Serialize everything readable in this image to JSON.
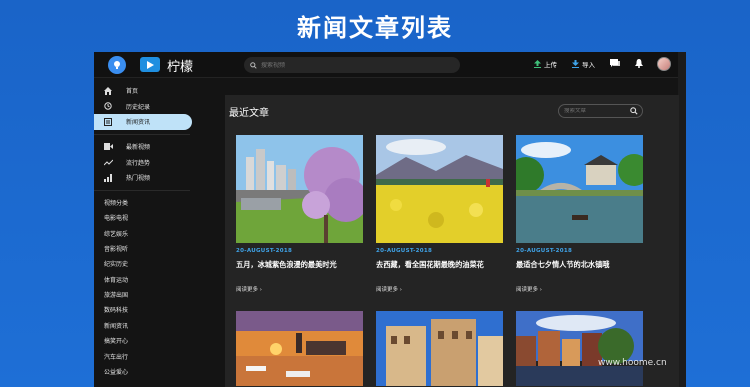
{
  "banner": {
    "title": "新闻文章列表"
  },
  "header": {
    "logo_text": "柠檬",
    "search_placeholder": "搜索视频",
    "upload_label": "上传",
    "import_label": "导入"
  },
  "sidebar": {
    "items": [
      {
        "label": "首页",
        "icon": "home-icon"
      },
      {
        "label": "历史纪录",
        "icon": "history-icon"
      },
      {
        "label": "新闻资讯",
        "icon": "news-icon",
        "active": true
      },
      {
        "label": "最新视频",
        "icon": "video-icon"
      },
      {
        "label": "流行趋势",
        "icon": "trend-icon"
      },
      {
        "label": "热门视频",
        "icon": "chart-icon"
      }
    ],
    "categories": [
      "视频分类",
      "电影电视",
      "综艺娱乐",
      "音影视听",
      "纪实历史",
      "体育运动",
      "旅游出国",
      "数码科技",
      "新闻资讯",
      "搞笑开心",
      "汽车出行",
      "公益爱心"
    ]
  },
  "main": {
    "section_title": "最近文章",
    "search_placeholder": "搜索文章",
    "articles": [
      {
        "date": "20-AUGUST-2018",
        "title": "五月，冰城紫色浪漫的最美时光",
        "more": "阅读更多 ›"
      },
      {
        "date": "20-AUGUST-2018",
        "title": "去西藏，看全国花期最晚的油菜花",
        "more": "阅读更多 ›"
      },
      {
        "date": "20-AUGUST-2018",
        "title": "最适合七夕情人节的北水镇哦",
        "more": "阅读更多 ›"
      }
    ]
  },
  "watermark": "www.hoome.cn",
  "colors": {
    "accent": "#3fa3e8",
    "banner_bg": "#1a64c8",
    "active_item": "#bfe2f8"
  }
}
